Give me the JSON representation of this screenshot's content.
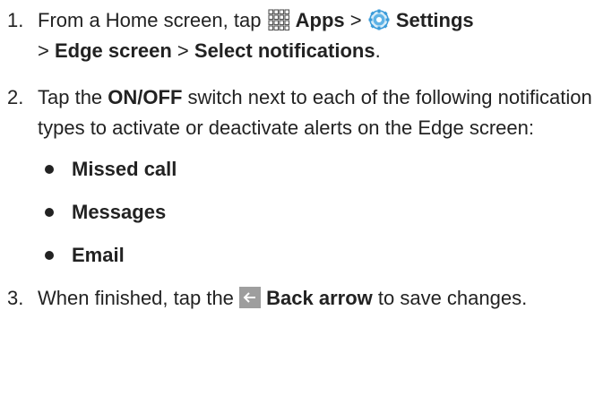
{
  "steps": [
    {
      "number": "1.",
      "t1": "From a Home screen, tap ",
      "apps_label": "Apps",
      "t2": " > ",
      "settings_label": "Settings",
      "t3": " > ",
      "edge_label": "Edge screen",
      "t4": " > ",
      "select_label": "Select notifications",
      "t5": "."
    },
    {
      "number": "2.",
      "t1": "Tap the ",
      "onoff_label": "ON/OFF",
      "t2": " switch next to each of the following notification types to activate or deactivate alerts on the Edge screen:",
      "bullets": [
        "Missed call",
        "Messages",
        "Email"
      ]
    },
    {
      "number": "3.",
      "t1": "When finished, tap the ",
      "back_label": "Back arrow",
      "t2": " to save changes."
    }
  ],
  "icons": {
    "apps": "apps-grid-icon",
    "settings": "settings-gear-icon",
    "back": "back-arrow-icon"
  },
  "colors": {
    "text": "#222222",
    "settings_icon": "#3a9bd9",
    "back_icon_bg": "#9e9e9e"
  }
}
